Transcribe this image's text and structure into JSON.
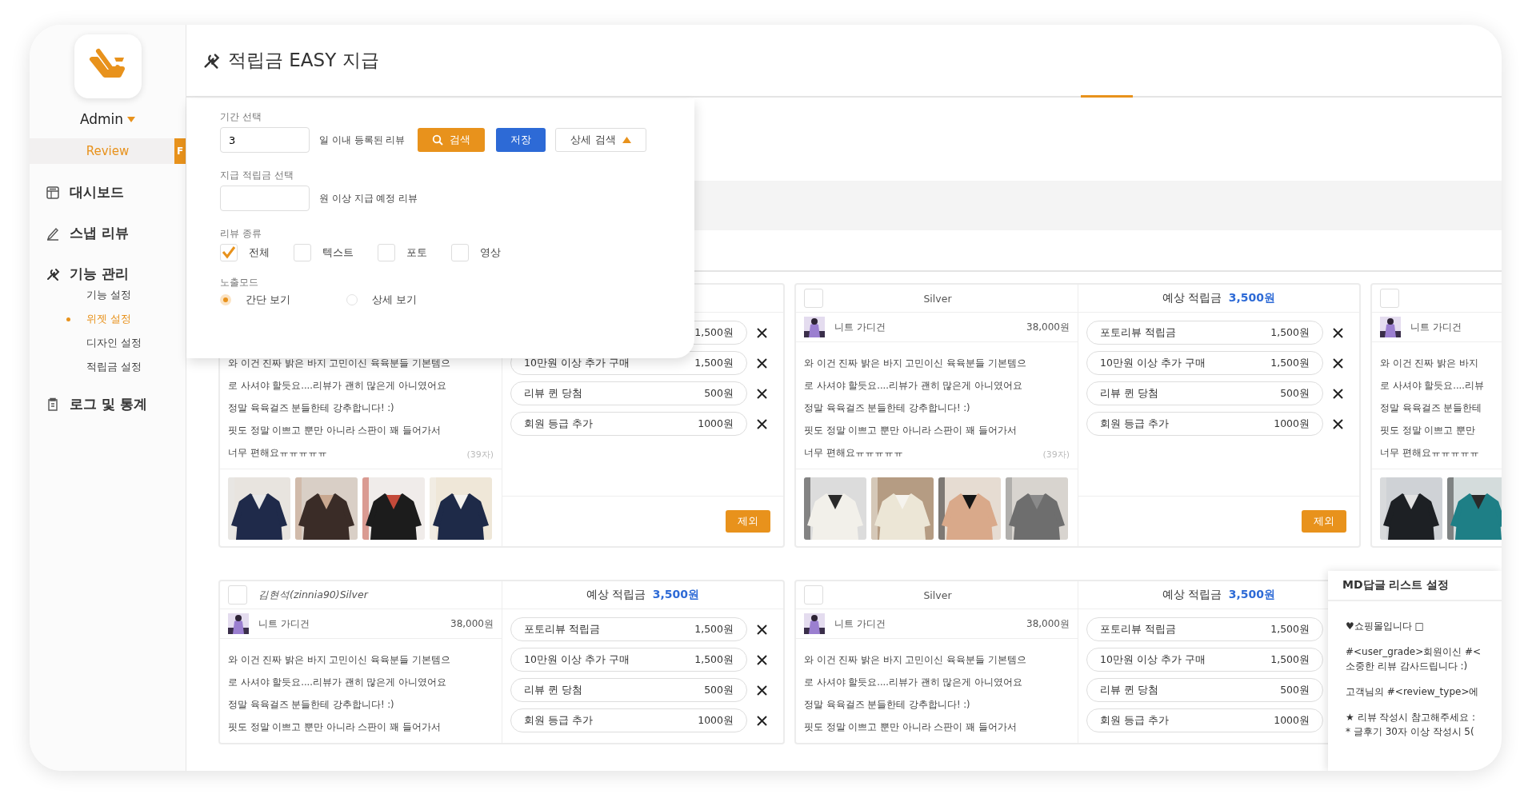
{
  "sidebar": {
    "user": "Admin",
    "section": {
      "label": "Review",
      "tab": "F"
    },
    "nav": [
      {
        "label": "대시보드"
      },
      {
        "label": "스냅 리뷰"
      },
      {
        "label": "기능 관리",
        "children": [
          {
            "label": "기능 설정",
            "selected": false
          },
          {
            "label": "위젯 설정",
            "selected": true
          },
          {
            "label": "디자인 설정",
            "selected": false
          },
          {
            "label": "적립금 설정",
            "selected": false
          }
        ]
      },
      {
        "label": "로그 및 통계"
      }
    ]
  },
  "page_title": "적립금 EASY 지급",
  "filter": {
    "period": {
      "label": "기간 선택",
      "value": "3",
      "suffix": "일 이내 등록된 리뷰"
    },
    "buttons": [
      {
        "label": "검색",
        "kind": "search"
      },
      {
        "label": "저장",
        "kind": "save"
      },
      {
        "label": "상세 검색",
        "kind": "toggle",
        "expanded": true
      }
    ],
    "amount": {
      "label": "지급 적립금 선택",
      "suffix": "원 이상 지급 예정 리뷰"
    },
    "review_type": {
      "label": "리뷰 종류",
      "options": [
        {
          "label": "전체",
          "checked": true
        },
        {
          "label": "텍스트",
          "checked": false
        },
        {
          "label": "포토",
          "checked": false
        },
        {
          "label": "영상",
          "checked": false
        }
      ]
    },
    "display_mode": {
      "label": "노출모드",
      "options": [
        {
          "label": "간단 보기",
          "selected": true
        },
        {
          "label": "상세 보기",
          "selected": false
        }
      ]
    }
  },
  "cards": [
    {
      "review_lines": [
        "와 이건 진짜 밝은 바지 고민이신 육육분들 기본템으",
        "로 사셔야 할듯요....리뷰가 괜히 많은게 아니였어요",
        "정말 육육걸즈 분들한테 강추합니다! :)",
        "핏도 정말 이쁘고 뿐만 아니라 스판이 꽤 들어가서",
        "너무 편해요ㅠㅠㅠㅠㅠ"
      ],
      "char_count": "(39자)",
      "photos": [
        {
          "kind": "picture"
        },
        {
          "kind": "picture"
        },
        {
          "kind": "picture"
        },
        {
          "kind": "picture"
        }
      ],
      "rewards": [
        {
          "amount": "1,500원",
          "removable": true
        },
        {
          "label": "10만원 이상 추가 구매",
          "amount": "1,500원",
          "removable": true
        },
        {
          "label": "리뷰 퀸 당첨",
          "amount": "500원",
          "removable": true
        },
        {
          "label": "회원 등급 추가",
          "amount": "1000원",
          "removable": true
        }
      ],
      "action": "제외"
    },
    {
      "selected": false,
      "user": "Silver",
      "reward": {
        "label": "예상 적립금",
        "amount": "3,500원"
      },
      "product": {
        "name": "니트 가디건",
        "price": "38,000원"
      },
      "review_lines": [
        "와 이건 진짜 밝은 바지 고민이신 육육분들 기본템으",
        "로 사셔야 할듯요....리뷰가 괜히 많은게 아니였어요",
        "정말 육육걸즈 분들한테 강추합니다! :)",
        "핏도 정말 이쁘고 뿐만 아니라 스판이 꽤 들어가서",
        "너무 편해요ㅠㅠㅠㅠㅠ"
      ],
      "char_count": "(39자)",
      "photos": [
        {
          "kind": "picture"
        },
        {
          "kind": "picture"
        },
        {
          "kind": "picture"
        },
        {
          "kind": "picture"
        }
      ],
      "rewards": [
        {
          "label": "포토리뷰 적립금",
          "amount": "1,500원",
          "removable": true
        },
        {
          "label": "10만원 이상 추가 구매",
          "amount": "1,500원",
          "removable": true
        },
        {
          "label": "리뷰 퀸 당첨",
          "amount": "500원",
          "removable": true
        },
        {
          "label": "회원 등급 추가",
          "amount": "1000원",
          "removable": true
        }
      ],
      "action": "제외"
    },
    {
      "selected": false,
      "product": {
        "name": "니트 가디건"
      },
      "review_lines": [
        "와 이건 진짜 밝은 바지",
        "로 사셔야 할듯요....리뷰",
        "정말 육육걸즈 분들한테",
        "핏도 정말 이쁘고 뿐만",
        "너무 편해요ㅠㅠㅠㅠㅠ"
      ],
      "photos": [
        {
          "kind": "picture"
        },
        {
          "kind": "picture"
        }
      ]
    },
    {
      "selected": false,
      "user": "김현석(zinnia90)Silver",
      "reward": {
        "label": "예상 적립금",
        "amount": "3,500원"
      },
      "product": {
        "name": "니트 가디건",
        "price": "38,000원"
      },
      "review_lines": [
        "와 이건 진짜 밝은 바지 고민이신 육육분들 기본템으",
        "로 사셔야 할듯요....리뷰가 괜히 많은게 아니였어요",
        "정말 육육걸즈 분들한테 강추합니다! :)",
        "핏도 정말 이쁘고 뿐만 아니라 스판이 꽤 들어가서"
      ],
      "rewards": [
        {
          "label": "포토리뷰 적립금",
          "amount": "1,500원",
          "removable": true
        },
        {
          "label": "10만원 이상 추가 구매",
          "amount": "1,500원",
          "removable": true
        },
        {
          "label": "리뷰 퀸 당첨",
          "amount": "500원",
          "removable": true
        },
        {
          "label": "회원 등급 추가",
          "amount": "1000원",
          "removable": true
        }
      ]
    },
    {
      "selected": false,
      "user": "Silver",
      "reward": {
        "label": "예상 적립금",
        "amount": "3,500원"
      },
      "product": {
        "name": "니트 가디건",
        "price": "38,000원"
      },
      "review_lines": [
        "와 이건 진짜 밝은 바지 고민이신 육육분들 기본템으",
        "로 사셔야 할듯요....리뷰가 괜히 많은게 아니였어요",
        "정말 육육걸즈 분들한테 강추합니다! :)",
        "핏도 정말 이쁘고 뿐만 아니라 스판이 꽤 들어가서"
      ],
      "rewards": [
        {
          "label": "포토리뷰 적립금",
          "amount": "1,500원",
          "removable": false
        },
        {
          "label": "10만원 이상 추가 구매",
          "amount": "1,500원",
          "removable": false
        },
        {
          "label": "리뷰 퀸 당첨",
          "amount": "500원",
          "removable": false
        },
        {
          "label": "회원 등급 추가",
          "amount": "1000원",
          "removable": false
        }
      ]
    }
  ],
  "md_panel": {
    "title": "MD답글 리스트 설정",
    "lines": [
      "♥쇼핑몰입니다 □",
      "#<user_grade>회원이신 #<",
      "소중한 리뷰 감사드립니다 :)",
      "고객님의 #<review_type>에",
      "★ 리뷰 작성시 참고해주세요 :",
      "* 글후기 30자 이상 작성시 5("
    ]
  }
}
